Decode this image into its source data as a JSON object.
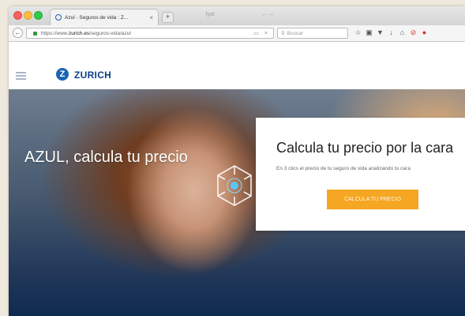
{
  "browser": {
    "tab_title": "Azul - Seguros de vida : Z...",
    "tab_close": "×",
    "new_tab": "+",
    "ghost_text_1": "lyst",
    "ghost_text_2": "← →",
    "back": "←",
    "url_prefix": "https://www.",
    "url_domain": "zurich.es",
    "url_path": "/seguros-vida/azul",
    "reader_icon": "▭",
    "reload_icon": "×",
    "search_placeholder": "Buscar",
    "toolbar_icons": [
      "star-icon",
      "clipboard-icon",
      "pocket-icon",
      "download-icon",
      "home-icon",
      "block-icon",
      "extension-icon"
    ]
  },
  "site": {
    "brand_name": "ZURICH",
    "brand_mark": "Z",
    "brand_color": "#1b64b4"
  },
  "hero": {
    "title": "AZUL, calcula tu precio",
    "card_title": "Calcula tu precio por la cara",
    "card_subtitle": "En 3 clics el precio de tu seguro de vida analizando tu cara",
    "cta_label": "CALCULA TU PRECIO",
    "cta_color": "#f5a623"
  }
}
